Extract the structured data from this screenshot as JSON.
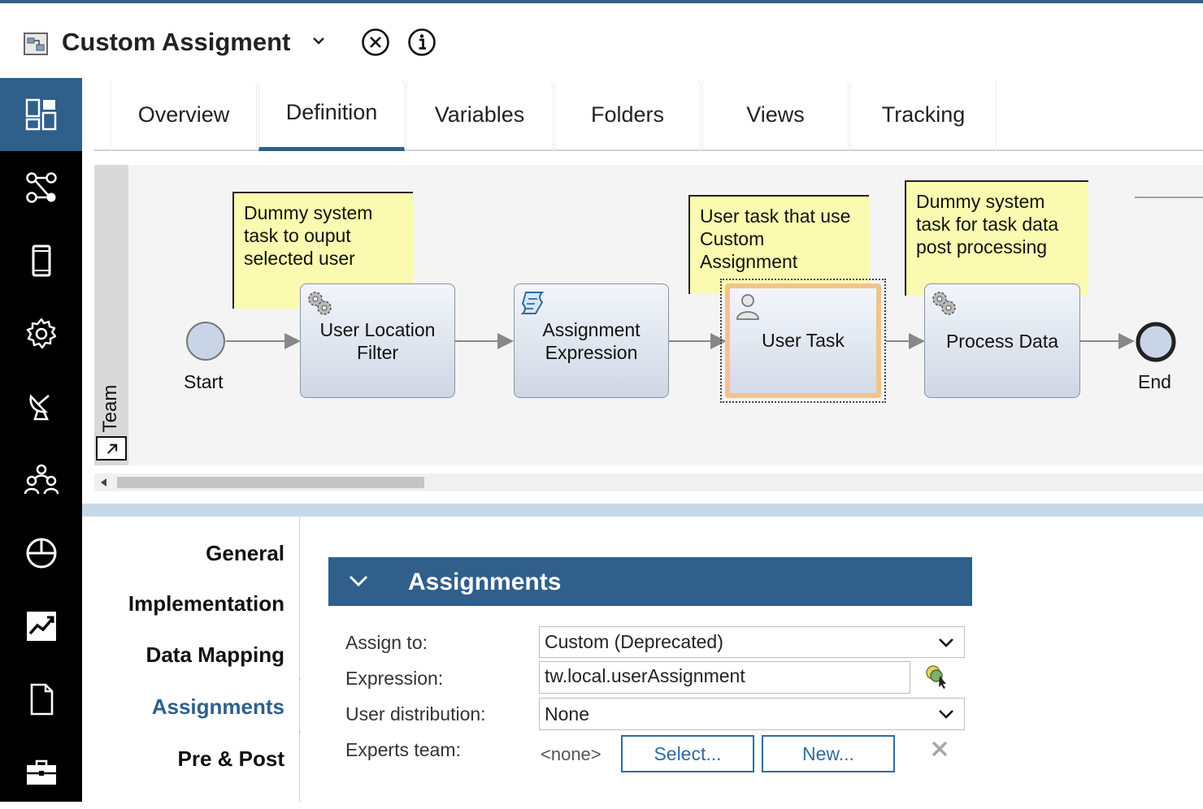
{
  "title": {
    "app_name": "Custom Assigment"
  },
  "tabs": [
    {
      "label": "Overview"
    },
    {
      "label": "Definition"
    },
    {
      "label": "Variables"
    },
    {
      "label": "Folders"
    },
    {
      "label": "Views"
    },
    {
      "label": "Tracking"
    }
  ],
  "active_tab": "Definition",
  "diagram": {
    "lane_label": "Team",
    "notes": {
      "note1": "Dummy system task to ouput selected user",
      "note2": "User task that use Custom Assignment",
      "note3": "Dummy system task for task data post processing"
    },
    "start_label": "Start",
    "end_label": "End",
    "tasks": {
      "location_filter": "User Location Filter",
      "assignment_expression": "Assignment Expression",
      "user_task": "User Task",
      "process_data": "Process Data"
    }
  },
  "property_tabs": [
    {
      "label": "General"
    },
    {
      "label": "Implementation"
    },
    {
      "label": "Data Mapping"
    },
    {
      "label": "Assignments"
    },
    {
      "label": "Pre & Post"
    }
  ],
  "assignments": {
    "section_title": "Assignments",
    "assign_to_label": "Assign to:",
    "assign_to_value": "Custom (Deprecated)",
    "expression_label": "Expression:",
    "expression_value": "tw.local.userAssignment",
    "distribution_label": "User distribution:",
    "distribution_value": "None",
    "experts_label": "Experts team:",
    "experts_value": "<none>",
    "select_button": "Select...",
    "new_button": "New..."
  },
  "colors": {
    "accent": "#2f5f8a",
    "nav_bg": "#000000",
    "note_bg": "#fafab0",
    "selection": "#f2c48a"
  }
}
